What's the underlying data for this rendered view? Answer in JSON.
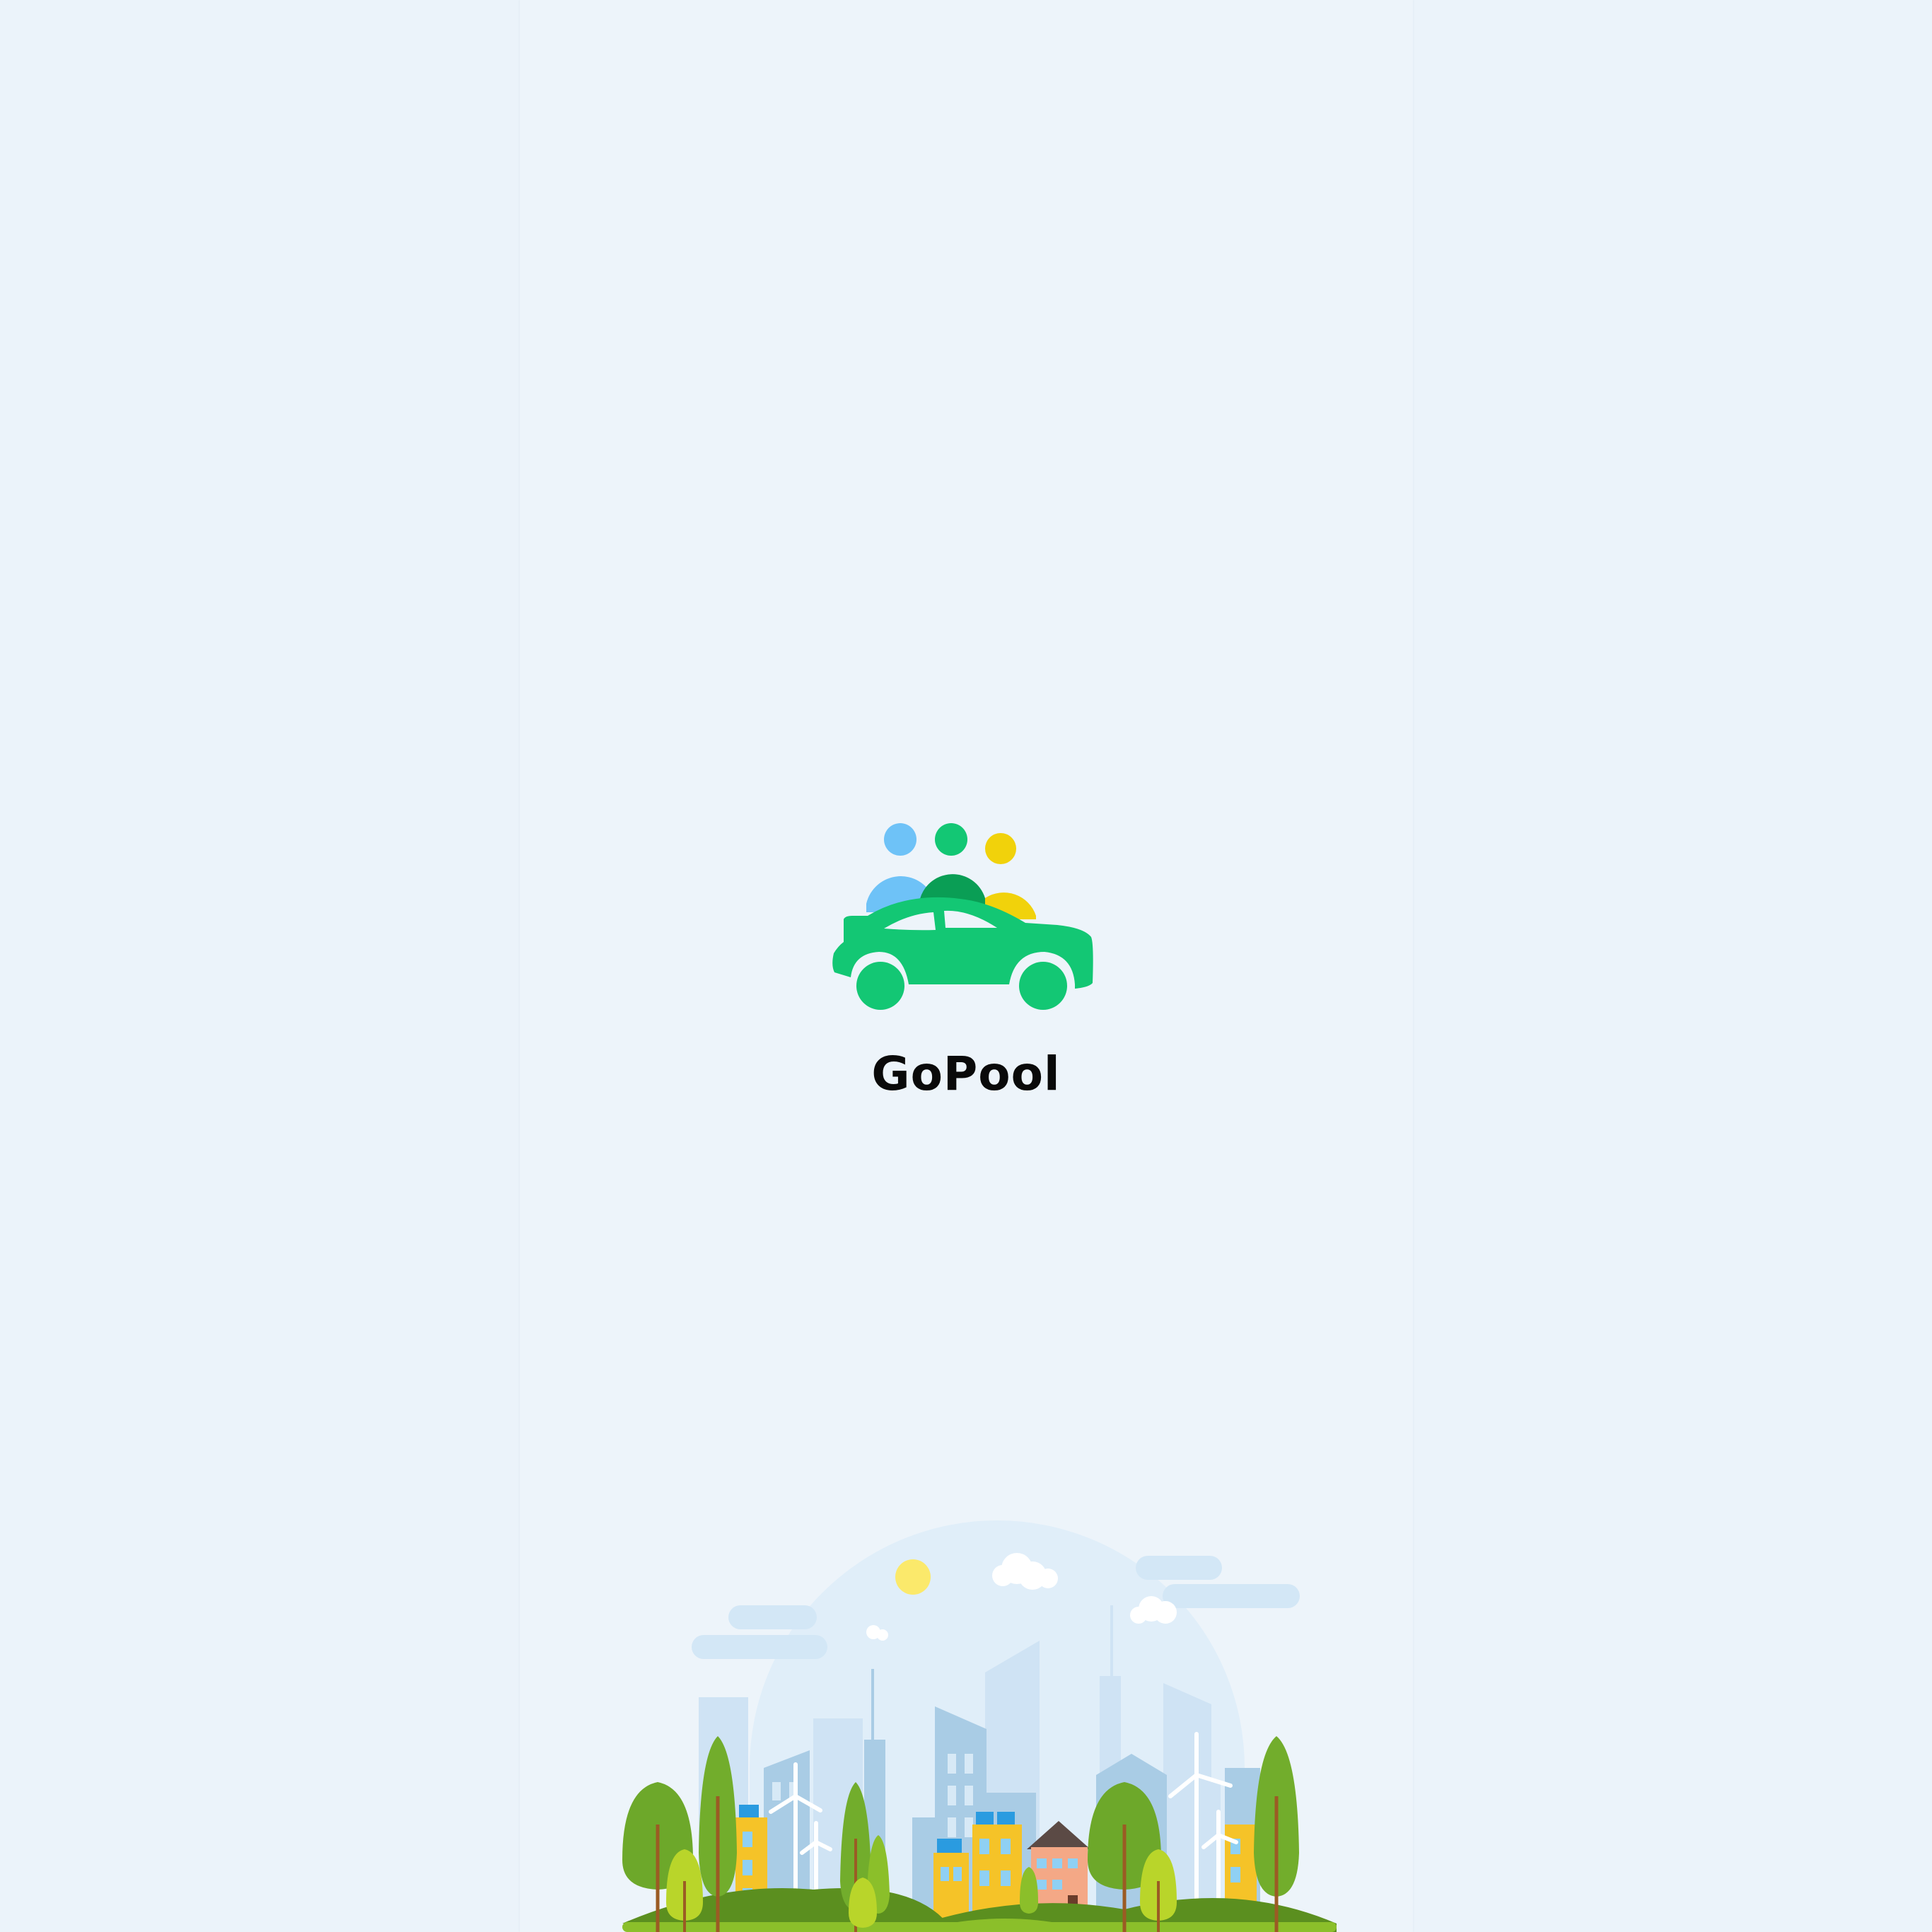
{
  "app": {
    "name": "GoPool"
  },
  "colors": {
    "background": "#ebf3fa",
    "brand_green": "#13c774",
    "person_blue": "#6ec2f7",
    "person_green": "#13c774",
    "person_yellow": "#f1d20b",
    "text": "#0a0a0a"
  },
  "logo": {
    "icon": "carpool-car-icon"
  },
  "illustration": {
    "icon": "green-city-skyline-illustration"
  }
}
